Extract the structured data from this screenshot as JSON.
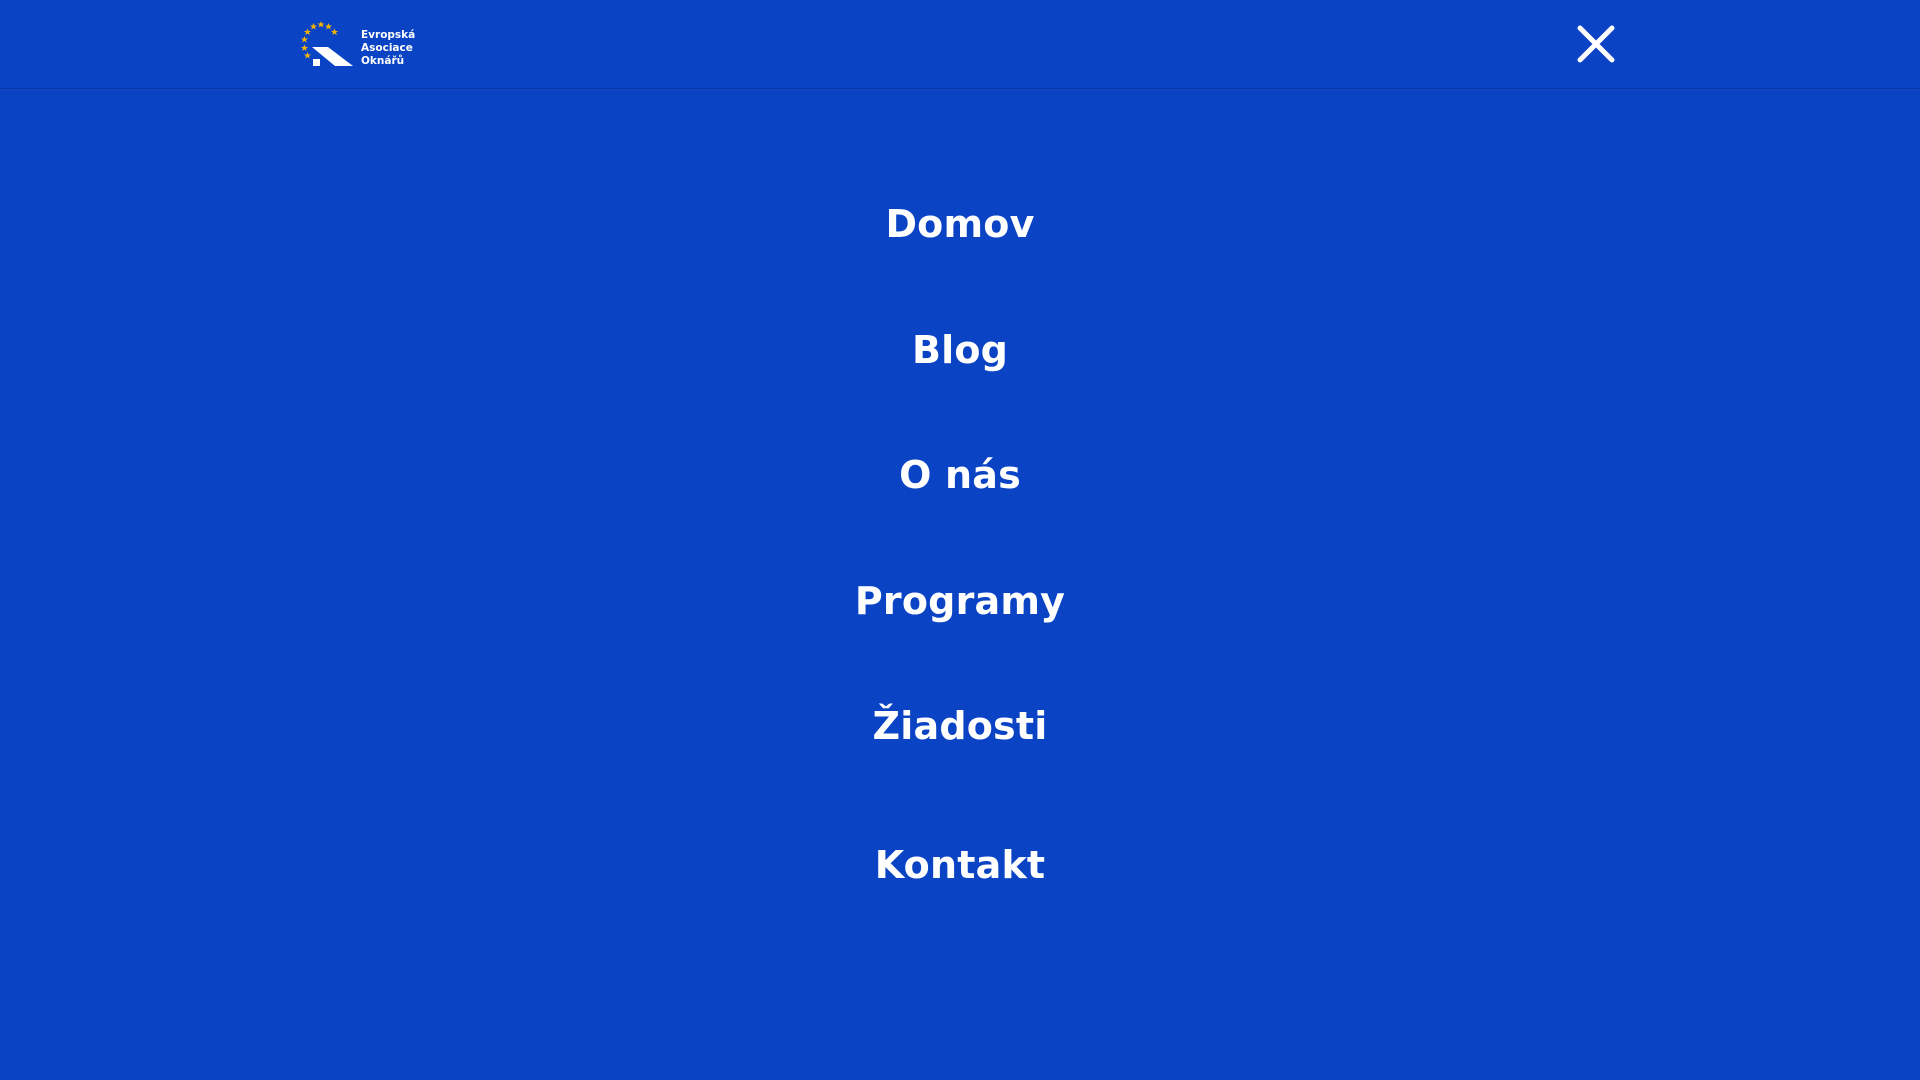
{
  "header": {
    "logo": {
      "lines": [
        "Evropská",
        "Asociace",
        "Oknářů"
      ]
    },
    "close_icon": "close-icon"
  },
  "menu": {
    "items": [
      {
        "label": "Domov"
      },
      {
        "label": "Blog"
      },
      {
        "label": "O nás"
      },
      {
        "label": "Programy"
      },
      {
        "label": "Žiadosti"
      },
      {
        "label": "Kontakt"
      }
    ]
  },
  "colors": {
    "background": "#0a43c4",
    "text": "#ffffff",
    "logo_stars": "#f5b400"
  }
}
